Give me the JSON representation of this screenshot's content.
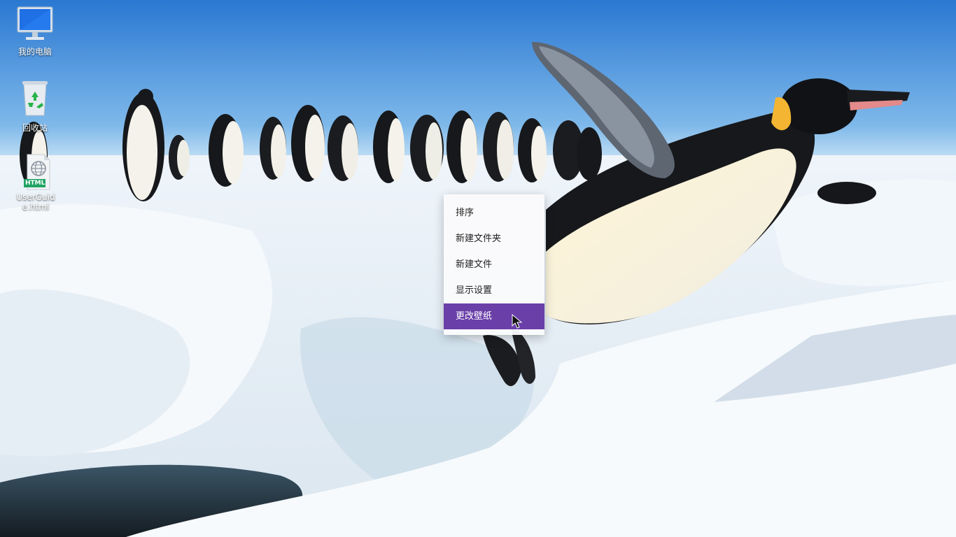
{
  "desktop": {
    "icons": [
      {
        "label": "我的电脑",
        "icon": "computer-icon"
      },
      {
        "label": "回收站",
        "icon": "recycle-bin-icon"
      },
      {
        "label": "UserGuide.html",
        "icon": "html-file-icon",
        "badge": "HTML"
      }
    ]
  },
  "context_menu": {
    "items": [
      {
        "label": "排序"
      },
      {
        "label": "新建文件夹"
      },
      {
        "label": "新建文件"
      },
      {
        "label": "显示设置"
      },
      {
        "label": "更改壁纸",
        "highlighted": true
      }
    ]
  },
  "colors": {
    "menu_highlight": "#6a3fa8",
    "sky_top": "#2f7fd6",
    "sky_horizon": "#cfe6f6",
    "snow": "#f4f8fb",
    "water": "#1e2a33"
  }
}
